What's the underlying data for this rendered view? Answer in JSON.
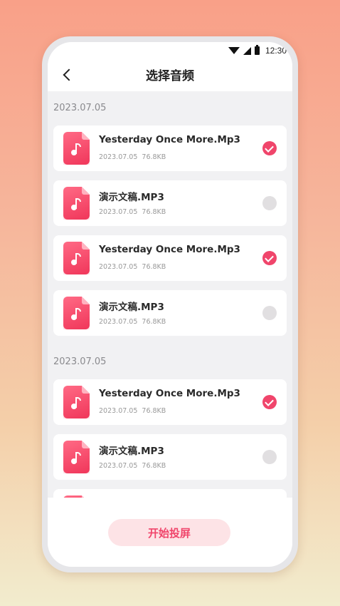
{
  "status_bar": {
    "time": "12:30",
    "icons": [
      "wifi-icon",
      "cell-signal-icon",
      "battery-icon"
    ]
  },
  "header": {
    "title": "选择音频",
    "back_icon": "chevron-left-icon"
  },
  "groups": [
    {
      "date": "2023.07.05",
      "items": [
        {
          "name": "Yesterday Once More.Mp3",
          "date": "2023.07.05",
          "size": "76.8KB",
          "selected": true
        },
        {
          "name": "演示文稿.MP3",
          "date": "2023.07.05",
          "size": "76.8KB",
          "selected": false
        },
        {
          "name": "Yesterday Once More.Mp3",
          "date": "2023.07.05",
          "size": "76.8KB",
          "selected": true
        },
        {
          "name": "演示文稿.MP3",
          "date": "2023.07.05",
          "size": "76.8KB",
          "selected": false
        }
      ]
    },
    {
      "date": "2023.07.05",
      "items": [
        {
          "name": "Yesterday Once More.Mp3",
          "date": "2023.07.05",
          "size": "76.8KB",
          "selected": true
        },
        {
          "name": "演示文稿.MP3",
          "date": "2023.07.05",
          "size": "76.8KB",
          "selected": false
        }
      ]
    }
  ],
  "footer": {
    "start_label": "开始投屏"
  },
  "colors": {
    "accent": "#f0456b",
    "button_bg": "#fde3e6",
    "page_bg": "#f1f1f3"
  }
}
